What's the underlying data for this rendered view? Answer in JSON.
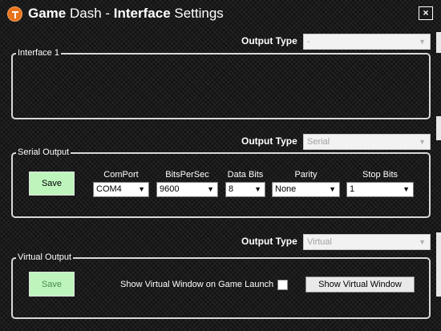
{
  "window": {
    "title_part1": "Game",
    "title_part2": " Dash - ",
    "title_part3": "Interface",
    "title_part4": " Settings",
    "close_label": "×"
  },
  "interface1": {
    "output_type_label": "Output Type",
    "output_type_value": "-",
    "group_title": "Interface 1"
  },
  "serial": {
    "output_type_label": "Output Type",
    "output_type_value": "Serial",
    "group_title": "Serial Output",
    "save_label": "Save",
    "fields": {
      "comport": {
        "label": "ComPort",
        "value": "COM4"
      },
      "bitspersec": {
        "label": "BitsPerSec",
        "value": "9600"
      },
      "databits": {
        "label": "Data Bits",
        "value": "8"
      },
      "parity": {
        "label": "Parity",
        "value": "None"
      },
      "stopbits": {
        "label": "Stop Bits",
        "value": "1"
      }
    }
  },
  "virtual": {
    "output_type_label": "Output Type",
    "output_type_value": "Virtual",
    "group_title": "Virtual Output",
    "save_label": "Save",
    "show_on_launch_label": "Show Virtual Window on Game Launch",
    "show_on_launch_checked": false,
    "show_window_button": "Show Virtual Window"
  },
  "colors": {
    "save_bg": "#bdf5bd",
    "logo": "#e8731e"
  }
}
